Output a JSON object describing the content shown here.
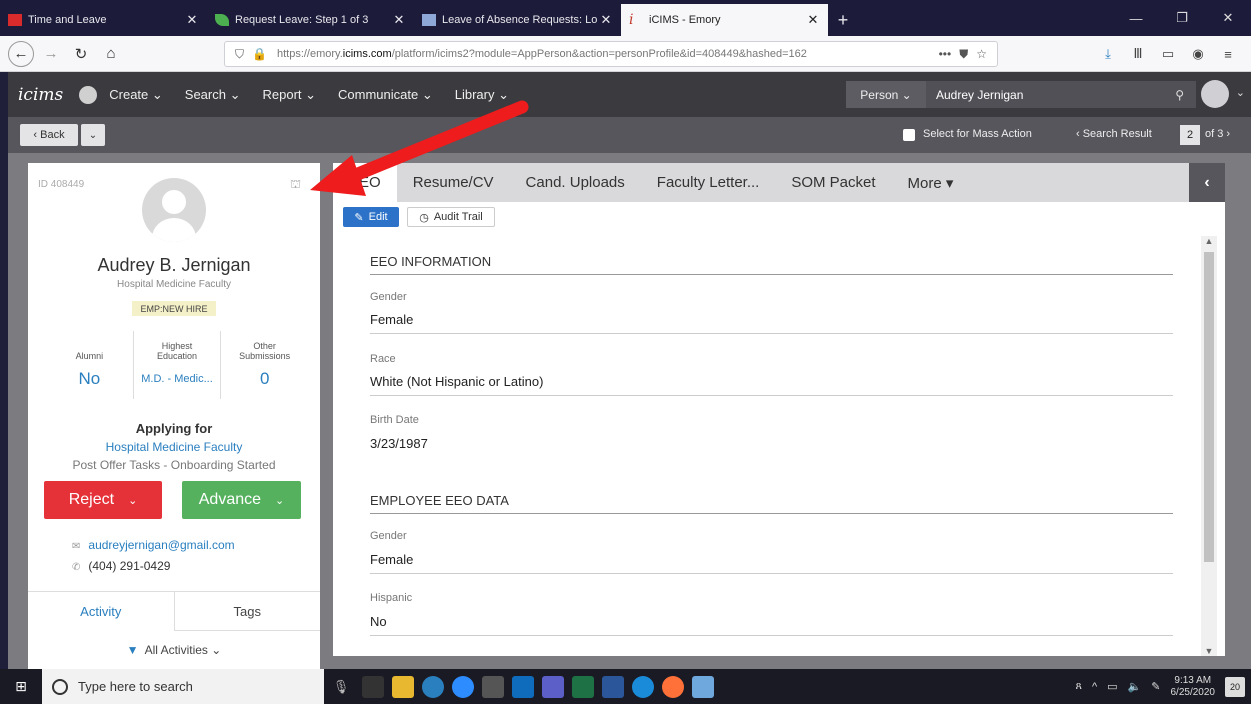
{
  "browser": {
    "tabs": [
      {
        "title": "Time and Leave",
        "active": false
      },
      {
        "title": "Request Leave: Step 1 of 3",
        "active": false
      },
      {
        "title": "Leave of Absence Requests: Lo",
        "active": false
      },
      {
        "title": "iCIMS - Emory",
        "active": true
      }
    ],
    "new_tab": "+",
    "url_prefix": "https://emory.",
    "url_domain": "icims.com",
    "url_rest": "/platform/icims2?module=AppPerson&action=personProfile&id=408449&hashed=162"
  },
  "app": {
    "logo": "icims",
    "menu": [
      {
        "label": "Create ⌄"
      },
      {
        "label": "Search ⌄"
      },
      {
        "label": "Report ⌄"
      },
      {
        "label": "Communicate ⌄"
      },
      {
        "label": "Library ⌄"
      }
    ],
    "search_type": "Person ⌄",
    "search_value": "Audrey Jernigan"
  },
  "subbar": {
    "back_label": "‹ Back",
    "mass_action_label": "Select for Mass Action",
    "search_result_label": "‹ Search Result",
    "search_result_index": "2",
    "search_result_total": "of 3 ›"
  },
  "profile": {
    "id_label": "ID 408449",
    "name": "Audrey B. Jernigan",
    "title": "Hospital Medicine Faculty",
    "badge": "EMP:NEW HIRE",
    "stats": [
      {
        "label": "Alumni",
        "value": "No"
      },
      {
        "label": "Highest Education",
        "value": "M.D. - Medic..."
      },
      {
        "label": "Other Submissions",
        "value": "0"
      }
    ],
    "applying_for_label": "Applying for",
    "applying_job": "Hospital Medicine Faculty",
    "applying_status": "Post Offer Tasks - Onboarding Started",
    "reject_label": "Reject",
    "advance_label": "Advance",
    "email": "audreyjernigan@gmail.com",
    "phone": "(404) 291-0429",
    "tabs": [
      {
        "label": "Activity"
      },
      {
        "label": "Tags"
      }
    ],
    "filter_label": "All Activities ⌄"
  },
  "content": {
    "tabs": [
      {
        "label": "EEO"
      },
      {
        "label": "Resume/CV"
      },
      {
        "label": "Cand. Uploads"
      },
      {
        "label": "Faculty Letter..."
      },
      {
        "label": "SOM Packet"
      },
      {
        "label": "More ▾"
      }
    ],
    "edit_label": "Edit",
    "audit_label": "Audit Trail",
    "sections": [
      {
        "title": "EEO INFORMATION",
        "fields": [
          {
            "label": "Gender",
            "value": "Female"
          },
          {
            "label": "Race",
            "value": "White (Not Hispanic or Latino)"
          },
          {
            "label": "Birth Date",
            "value": "3/23/1987"
          }
        ]
      },
      {
        "title": "EMPLOYEE EEO DATA",
        "fields": [
          {
            "label": "Gender",
            "value": "Female"
          },
          {
            "label": "Hispanic",
            "value": "No"
          }
        ]
      }
    ]
  },
  "taskbar": {
    "search_placeholder": "Type here to search",
    "time": "9:13 AM",
    "date": "6/25/2020",
    "notifications": "20"
  },
  "colors": {
    "reject": "#e53238",
    "advance": "#55b15e",
    "link": "#2a7fbf",
    "annotation_arrow": "#ee1c1c"
  }
}
